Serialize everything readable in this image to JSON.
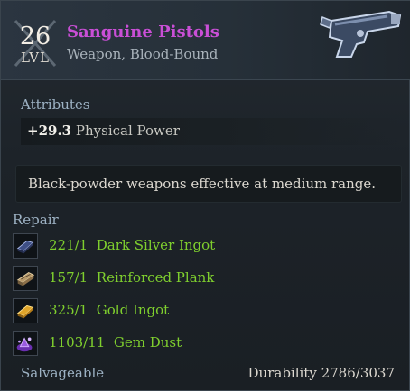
{
  "item": {
    "level": "26",
    "level_label": "LVL",
    "name": "Sanguine Pistols",
    "type": "Weapon, Blood-Bound",
    "icon": "pistol-icon",
    "rarity_color": "#c94fd6"
  },
  "attributes": {
    "title": "Attributes",
    "rows": [
      {
        "value": "+29.3",
        "name": "Physical Power"
      }
    ]
  },
  "description": "Black-powder weapons effective at medium range.",
  "repair": {
    "title": "Repair",
    "materials": [
      {
        "amount": "221/1",
        "name": "Dark Silver Ingot",
        "icon": "dark-silver-ingot-icon"
      },
      {
        "amount": "157/1",
        "name": "Reinforced Plank",
        "icon": "reinforced-plank-icon"
      },
      {
        "amount": "325/1",
        "name": "Gold Ingot",
        "icon": "gold-ingot-icon"
      },
      {
        "amount": "1103/11",
        "name": "Gem Dust",
        "icon": "gem-dust-icon"
      }
    ],
    "amount_color": "#7fcf2e"
  },
  "footer": {
    "salvageable": "Salvageable",
    "durability": "Durability 2786/3037"
  }
}
